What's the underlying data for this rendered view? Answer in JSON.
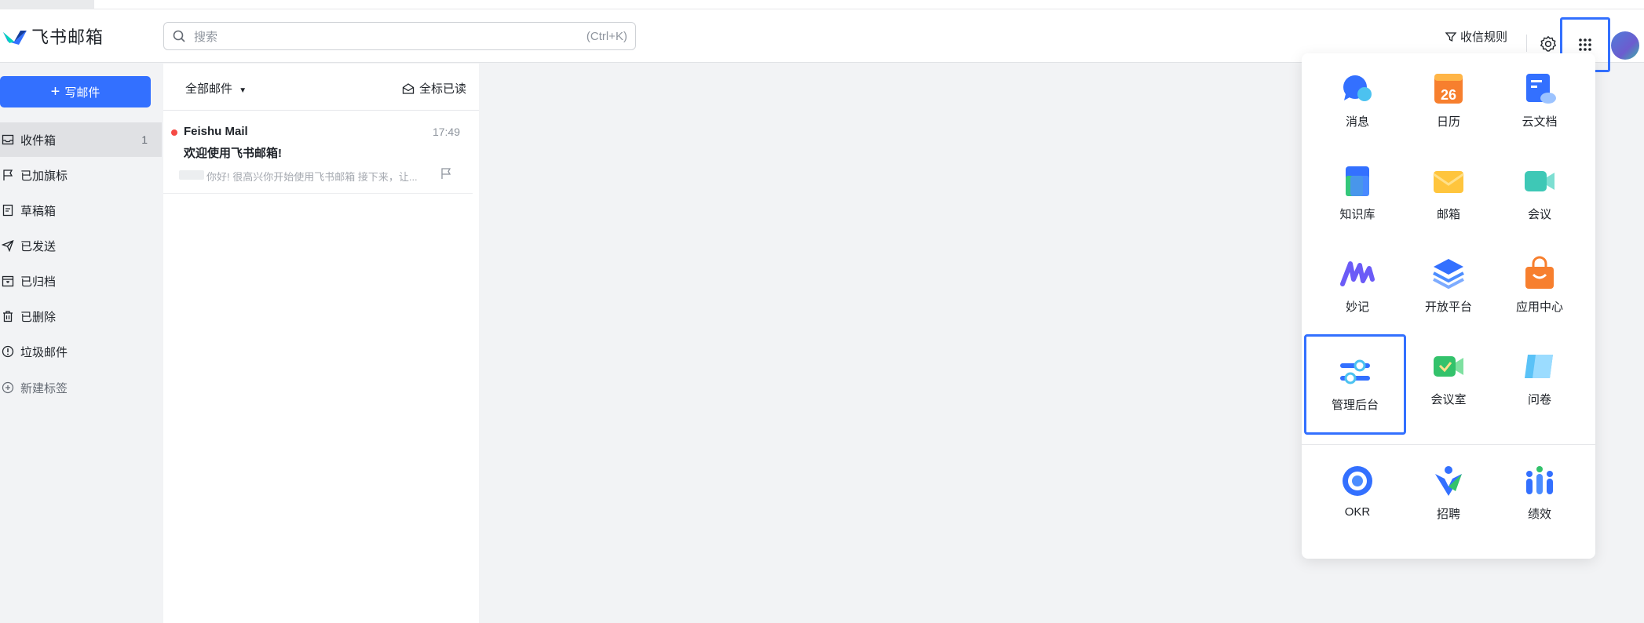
{
  "app": {
    "logo_text": "飞书邮箱"
  },
  "search": {
    "placeholder": "搜索",
    "shortcut": "(Ctrl+K)"
  },
  "header": {
    "rules_label": "收信规则"
  },
  "sidebar": {
    "compose_label": "写邮件",
    "items": [
      {
        "label": "收件箱",
        "icon": "inbox-icon",
        "count": "1",
        "active": true
      },
      {
        "label": "已加旗标",
        "icon": "flag-icon"
      },
      {
        "label": "草稿箱",
        "icon": "draft-icon"
      },
      {
        "label": "已发送",
        "icon": "send-icon"
      },
      {
        "label": "已归档",
        "icon": "archive-icon"
      },
      {
        "label": "已删除",
        "icon": "trash-icon"
      },
      {
        "label": "垃圾邮件",
        "icon": "spam-icon"
      },
      {
        "label": "新建标签",
        "icon": "add-label-icon"
      }
    ]
  },
  "maillist": {
    "filter_label": "全部邮件",
    "mark_all_read_label": "全标已读",
    "mails": [
      {
        "sender": "Feishu Mail",
        "time": "17:49",
        "subject": "欢迎使用飞书邮箱!",
        "preview": "你好! 很高兴你开始使用飞书邮箱 接下来，让..."
      }
    ]
  },
  "apps": [
    {
      "label": "消息",
      "icon": "message-icon"
    },
    {
      "label": "日历",
      "icon": "calendar-icon",
      "badge": "26"
    },
    {
      "label": "云文档",
      "icon": "docs-icon"
    },
    {
      "label": "知识库",
      "icon": "wiki-icon"
    },
    {
      "label": "邮箱",
      "icon": "mail-icon"
    },
    {
      "label": "会议",
      "icon": "meeting-icon"
    },
    {
      "label": "妙记",
      "icon": "minutes-icon"
    },
    {
      "label": "开放平台",
      "icon": "open-platform-icon"
    },
    {
      "label": "应用中心",
      "icon": "app-center-icon"
    },
    {
      "label": "管理后台",
      "icon": "admin-icon",
      "selected": true
    },
    {
      "label": "会议室",
      "icon": "meeting-room-icon"
    },
    {
      "label": "问卷",
      "icon": "survey-icon"
    },
    {
      "label": "OKR",
      "icon": "okr-icon"
    },
    {
      "label": "招聘",
      "icon": "hire-icon"
    },
    {
      "label": "绩效",
      "icon": "performance-icon"
    }
  ],
  "colors": {
    "accent": "#3370ff",
    "unread": "#f54a45"
  }
}
